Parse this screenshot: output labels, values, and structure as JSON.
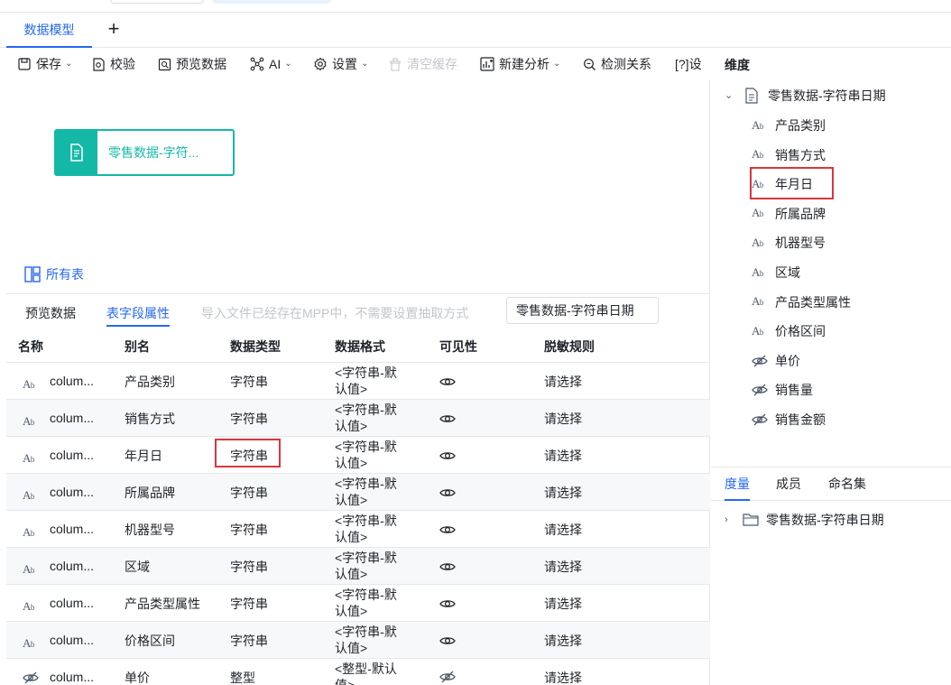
{
  "top_tabs": {
    "active": "数据模型",
    "add": "+"
  },
  "toolbar": {
    "save": "保存",
    "validate": "校验",
    "preview": "预览数据",
    "ai": "AI",
    "settings": "设置",
    "clear_cache": "清空缓存",
    "new_analysis": "新建分析",
    "detect_relation": "检测关系",
    "more": "[?]设"
  },
  "canvas": {
    "node_label": "零售数据-字符...",
    "all_tables": "所有表"
  },
  "lower": {
    "tabs": [
      "预览数据",
      "表字段属性"
    ],
    "active_tab": "表字段属性",
    "hint": "导入文件已经存在MPP中，不需要设置抽取方式",
    "table_select": "零售数据-字符串日期",
    "headers": [
      "名称",
      "别名",
      "数据类型",
      "数据格式",
      "可见性",
      "脱敏规则"
    ],
    "rows": [
      {
        "icon": "text-type-icon",
        "name": "colum...",
        "alias": "产品类别",
        "type": "字符串",
        "fmt1": "<字符串-默",
        "fmt2": "认值>",
        "vis": "eye-icon",
        "rule": "请选择"
      },
      {
        "icon": "text-type-icon",
        "name": "colum...",
        "alias": "销售方式",
        "type": "字符串",
        "fmt1": "<字符串-默",
        "fmt2": "认值>",
        "vis": "eye-icon",
        "rule": "请选择"
      },
      {
        "icon": "text-type-icon",
        "name": "colum...",
        "alias": "年月日",
        "type": "字符串",
        "fmt1": "<字符串-默",
        "fmt2": "认值>",
        "vis": "eye-icon",
        "rule": "请选择"
      },
      {
        "icon": "text-type-icon",
        "name": "colum...",
        "alias": "所属品牌",
        "type": "字符串",
        "fmt1": "<字符串-默",
        "fmt2": "认值>",
        "vis": "eye-icon",
        "rule": "请选择"
      },
      {
        "icon": "text-type-icon",
        "name": "colum...",
        "alias": "机器型号",
        "type": "字符串",
        "fmt1": "<字符串-默",
        "fmt2": "认值>",
        "vis": "eye-icon",
        "rule": "请选择"
      },
      {
        "icon": "text-type-icon",
        "name": "colum...",
        "alias": "区域",
        "type": "字符串",
        "fmt1": "<字符串-默",
        "fmt2": "认值>",
        "vis": "eye-icon",
        "rule": "请选择"
      },
      {
        "icon": "text-type-icon",
        "name": "colum...",
        "alias": "产品类型属性",
        "type": "字符串",
        "fmt1": "<字符串-默",
        "fmt2": "认值>",
        "vis": "eye-icon",
        "rule": "请选择"
      },
      {
        "icon": "text-type-icon",
        "name": "colum...",
        "alias": "价格区间",
        "type": "字符串",
        "fmt1": "<字符串-默",
        "fmt2": "认值>",
        "vis": "eye-icon",
        "rule": "请选择"
      },
      {
        "icon": "hidden-eye-icon",
        "name": "colum...",
        "alias": "单价",
        "type": "整型",
        "fmt1": "<整型-默认",
        "fmt2": "值>",
        "vis": "eye-off-icon",
        "rule": "请选择"
      }
    ]
  },
  "right": {
    "dim_title": "维度",
    "root": "零售数据-字符串日期",
    "fields": [
      {
        "label": "产品类别",
        "icon": "text-type-icon"
      },
      {
        "label": "销售方式",
        "icon": "text-type-icon"
      },
      {
        "label": "年月日",
        "icon": "text-type-icon"
      },
      {
        "label": "所属品牌",
        "icon": "text-type-icon"
      },
      {
        "label": "机器型号",
        "icon": "text-type-icon"
      },
      {
        "label": "区域",
        "icon": "text-type-icon"
      },
      {
        "label": "产品类型属性",
        "icon": "text-type-icon"
      },
      {
        "label": "价格区间",
        "icon": "text-type-icon"
      },
      {
        "label": "单价",
        "icon": "eye-off-icon"
      },
      {
        "label": "销售量",
        "icon": "eye-off-icon"
      },
      {
        "label": "销售金额",
        "icon": "eye-off-icon"
      }
    ],
    "measure_tabs": [
      "度量",
      "成员",
      "命名集"
    ],
    "measure_active": "度量",
    "measure_root": "零售数据-字符串日期"
  },
  "colors": {
    "accent": "#2468f2",
    "teal": "#14b8a6",
    "highlight": "#d9363e"
  }
}
